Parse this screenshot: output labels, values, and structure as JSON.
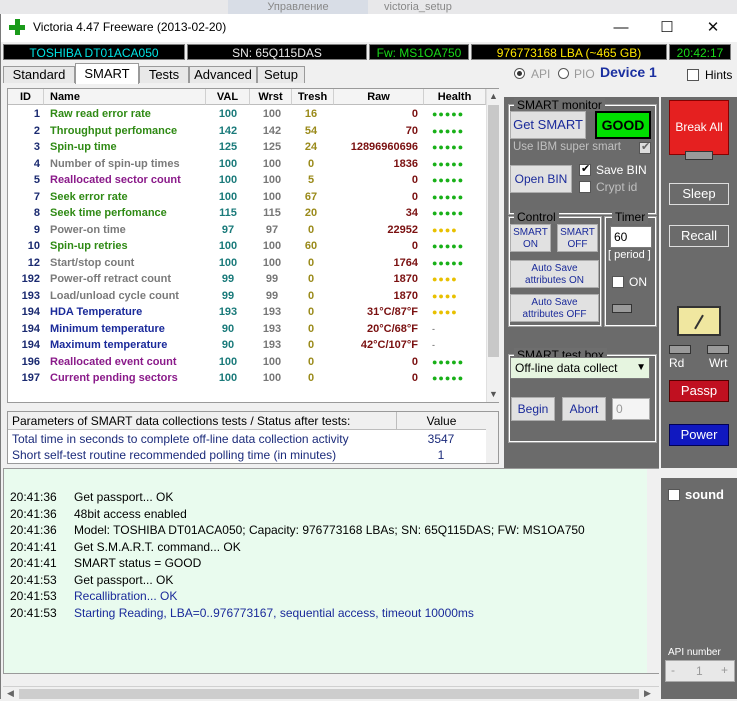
{
  "background_tabs": [
    "Управление",
    "victoria_setup"
  ],
  "window": {
    "title": "Victoria 4.47  Freeware (2013-02-20)",
    "controls": {
      "minimize": "—",
      "maximize": "☐",
      "close": "✕"
    }
  },
  "info_bar": {
    "model": "TOSHIBA DT01ACA050",
    "serial": "SN: 65Q115DAS",
    "firmware": "Fw: MS1OA750",
    "capacity": "976773168 LBA (~465 GB)",
    "clock": "20:42:17"
  },
  "tabs": [
    {
      "label": "Standard",
      "active": false
    },
    {
      "label": "SMART",
      "active": true
    },
    {
      "label": "Tests",
      "active": false
    },
    {
      "label": "Advanced",
      "active": false
    },
    {
      "label": "Setup",
      "active": false
    }
  ],
  "mode": {
    "api_label": "API",
    "pio_label": "PIO",
    "device_label": "Device 1",
    "hints_label": "Hints"
  },
  "smart_table": {
    "columns": [
      "ID",
      "Name",
      "VAL",
      "Wrst",
      "Tresh",
      "Raw",
      "Health"
    ],
    "rows": [
      {
        "id": "1",
        "name": "Raw read error rate",
        "val": "100",
        "wrst": "100",
        "tresh": "16",
        "raw": "0",
        "health": "●●●●●",
        "name_color": "green",
        "health_color": "green"
      },
      {
        "id": "2",
        "name": "Throughput perfomance",
        "val": "142",
        "wrst": "142",
        "tresh": "54",
        "raw": "70",
        "health": "●●●●●",
        "name_color": "green",
        "health_color": "green"
      },
      {
        "id": "3",
        "name": "Spin-up time",
        "val": "125",
        "wrst": "125",
        "tresh": "24",
        "raw": "12896960696",
        "health": "●●●●●",
        "name_color": "green",
        "health_color": "green"
      },
      {
        "id": "4",
        "name": "Number of spin-up times",
        "val": "100",
        "wrst": "100",
        "tresh": "0",
        "raw": "1836",
        "health": "●●●●●",
        "name_color": "gray",
        "health_color": "green"
      },
      {
        "id": "5",
        "name": "Reallocated sector count",
        "val": "100",
        "wrst": "100",
        "tresh": "5",
        "raw": "0",
        "health": "●●●●●",
        "name_color": "purple",
        "health_color": "green"
      },
      {
        "id": "7",
        "name": "Seek error rate",
        "val": "100",
        "wrst": "100",
        "tresh": "67",
        "raw": "0",
        "health": "●●●●●",
        "name_color": "green",
        "health_color": "green"
      },
      {
        "id": "8",
        "name": "Seek time perfomance",
        "val": "115",
        "wrst": "115",
        "tresh": "20",
        "raw": "34",
        "health": "●●●●●",
        "name_color": "green",
        "health_color": "green"
      },
      {
        "id": "9",
        "name": "Power-on time",
        "val": "97",
        "wrst": "97",
        "tresh": "0",
        "raw": "22952",
        "health": "●●●●",
        "name_color": "gray",
        "health_color": "yellow"
      },
      {
        "id": "10",
        "name": "Spin-up retries",
        "val": "100",
        "wrst": "100",
        "tresh": "60",
        "raw": "0",
        "health": "●●●●●",
        "name_color": "green",
        "health_color": "green"
      },
      {
        "id": "12",
        "name": "Start/stop count",
        "val": "100",
        "wrst": "100",
        "tresh": "0",
        "raw": "1764",
        "health": "●●●●●",
        "name_color": "gray",
        "health_color": "green"
      },
      {
        "id": "192",
        "name": "Power-off retract count",
        "val": "99",
        "wrst": "99",
        "tresh": "0",
        "raw": "1870",
        "health": "●●●●",
        "name_color": "gray",
        "health_color": "yellow"
      },
      {
        "id": "193",
        "name": "Load/unload cycle count",
        "val": "99",
        "wrst": "99",
        "tresh": "0",
        "raw": "1870",
        "health": "●●●●",
        "name_color": "gray",
        "health_color": "yellow"
      },
      {
        "id": "194",
        "name": "HDA Temperature",
        "val": "193",
        "wrst": "193",
        "tresh": "0",
        "raw": "31°C/87°F",
        "health": "●●●●",
        "name_color": "blue",
        "health_color": "yellow"
      },
      {
        "id": "194",
        "name": "Minimum temperature",
        "val": "90",
        "wrst": "193",
        "tresh": "0",
        "raw": "20°C/68°F",
        "health": "-",
        "name_color": "blue",
        "health_color": "dash"
      },
      {
        "id": "194",
        "name": "Maximum temperature",
        "val": "90",
        "wrst": "193",
        "tresh": "0",
        "raw": "42°C/107°F",
        "health": "-",
        "name_color": "blue",
        "health_color": "dash"
      },
      {
        "id": "196",
        "name": "Reallocated event count",
        "val": "100",
        "wrst": "100",
        "tresh": "0",
        "raw": "0",
        "health": "●●●●●",
        "name_color": "purple",
        "health_color": "green"
      },
      {
        "id": "197",
        "name": "Current pending sectors",
        "val": "100",
        "wrst": "100",
        "tresh": "0",
        "raw": "0",
        "health": "●●●●●",
        "name_color": "purple",
        "health_color": "green"
      }
    ]
  },
  "params_table": {
    "header": "Parameters of SMART data collections tests / Status after tests:",
    "value_header": "Value",
    "rows": [
      {
        "label": "Total time in seconds to complete off-line data collection activity",
        "value": "3547"
      },
      {
        "label": "Short self-test routine recommended polling time (in minutes)",
        "value": "1"
      }
    ]
  },
  "smart_monitor": {
    "label": "SMART monitor",
    "get_smart": "Get SMART",
    "status": "GOOD",
    "status_color": "#00e000",
    "ibm_label": "Use IBM super smart",
    "open_bin": "Open BIN",
    "save_bin": "Save BIN",
    "crypt_id": "Crypt id"
  },
  "control": {
    "label": "Control",
    "smart_on": "SMART ON",
    "smart_off": "SMART OFF",
    "autosave_on": "Auto Save attributes ON",
    "autosave_off": "Auto Save attributes OFF"
  },
  "timer": {
    "label": "Timer",
    "value": "60",
    "period": "[ period ]",
    "on_label": "ON"
  },
  "test_box": {
    "label": "SMART test box",
    "selected": "Off-line data collect",
    "begin": "Begin",
    "abort": "Abort",
    "count": "0"
  },
  "side": {
    "break_all": "Break All",
    "sleep": "Sleep",
    "recall": "Recall",
    "rd": "Rd",
    "wrt": "Wrt",
    "passp": "Passp",
    "power": "Power",
    "sound": "sound",
    "api_number_label": "API number",
    "api_number_value": "1",
    "minus": "-",
    "plus": "+"
  },
  "log": [
    {
      "time": "20:41:36",
      "msg": "Get passport... OK",
      "color": "black"
    },
    {
      "time": "20:41:36",
      "msg": "48bit access enabled",
      "color": "black"
    },
    {
      "time": "20:41:36",
      "msg": "Model: TOSHIBA DT01ACA050; Capacity: 976773168 LBAs; SN: 65Q115DAS; FW: MS1OA750",
      "color": "black"
    },
    {
      "time": "20:41:41",
      "msg": "Get S.M.A.R.T. command... OK",
      "color": "black"
    },
    {
      "time": "20:41:41",
      "msg": "SMART status = GOOD",
      "color": "black"
    },
    {
      "time": "20:41:53",
      "msg": "Get passport... OK",
      "color": "black"
    },
    {
      "time": "20:41:53",
      "msg": "Recallibration... OK",
      "color": "blue"
    },
    {
      "time": "20:41:53",
      "msg": "Starting Reading, LBA=0..976773167, sequential access, timeout 10000ms",
      "color": "blue"
    }
  ]
}
